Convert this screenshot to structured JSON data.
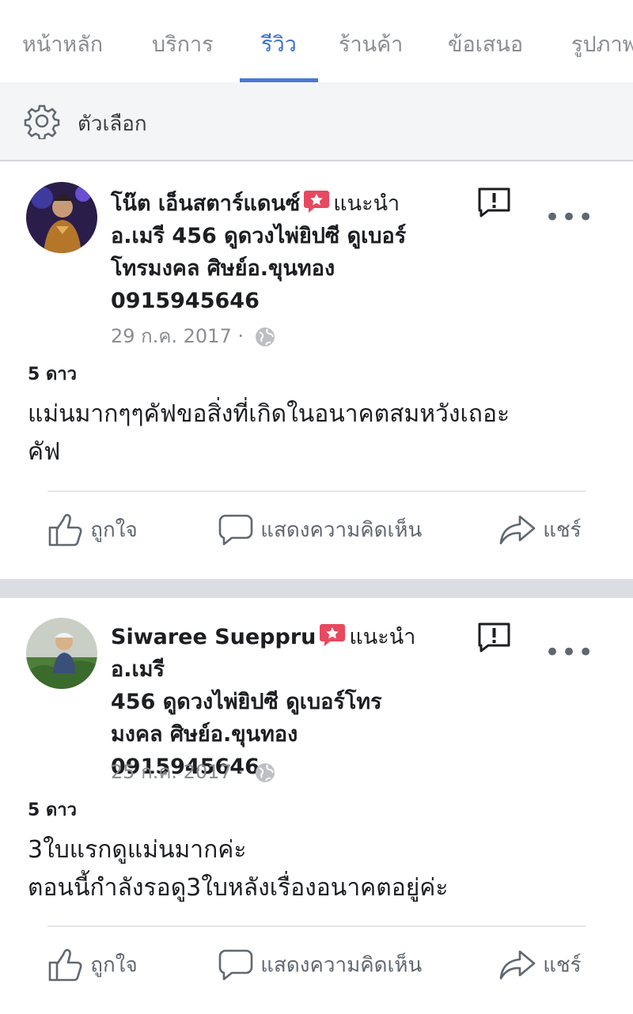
{
  "tabs": [
    {
      "label": "หน้าหลัก",
      "active": false
    },
    {
      "label": "บริการ",
      "active": false
    },
    {
      "label": "รีวิว",
      "active": true
    },
    {
      "label": "ร้านค้า",
      "active": false
    },
    {
      "label": "ข้อเสนอ",
      "active": false
    },
    {
      "label": "รูปภาพ",
      "active": false
    }
  ],
  "options": {
    "label": "ตัวเลือก",
    "icon": "gear-icon"
  },
  "colors": {
    "accent": "#4a78d6",
    "recommend": "#e8495f",
    "muted": "#8a8d91"
  },
  "posts": [
    {
      "author": "โน๊ต เอ็นสตาร์แดนซ์",
      "recommends_word": "แนะนำ",
      "page_name": "อ.เมรี 456 ดูดวงไพ่ยิปซี ดูเบอร์โทรมงคล ศิษย์อ.ขุนทอง 0915945646",
      "page_line1": "อ.เมรี 456 ดูดวงไพ่ยิปซี ดูเบอร์",
      "page_line2": "โทรมงคล ศิษย์อ.ขุนทอง",
      "page_line3": "0915945646",
      "date": "29 ก.ค. 2017",
      "dot": "·",
      "rating": "5 ดาว",
      "text_line1": "แม่นมากๆๆคัฟขอสิ่งที่เกิดในอนาคตสมหวังเถอะ",
      "text_line2": "คัฟ"
    },
    {
      "author": "Siwaree Sueppru",
      "recommends_word": "แนะนำ",
      "page_line0": "อ.เมรี",
      "page_line1": "456 ดูดวงไพ่ยิปซี ดูเบอร์โทร",
      "page_line2": "มงคล ศิษย์อ.ขุนทอง",
      "page_line3": "0915945646",
      "date": "25 ก.ค. 2017",
      "dot": "·",
      "rating": "5 ดาว",
      "text_line1": "3ใบแรกดูแม่นมากค่ะ",
      "text_line2": "ตอนนี้กำลังรอดู3ใบหลังเรื่องอนาคตอยู่ค่ะ"
    }
  ],
  "actions": {
    "like": "ถูกใจ",
    "comment": "แสดงความคิดเห็น",
    "share": "แชร์"
  },
  "more_glyph": "•••"
}
